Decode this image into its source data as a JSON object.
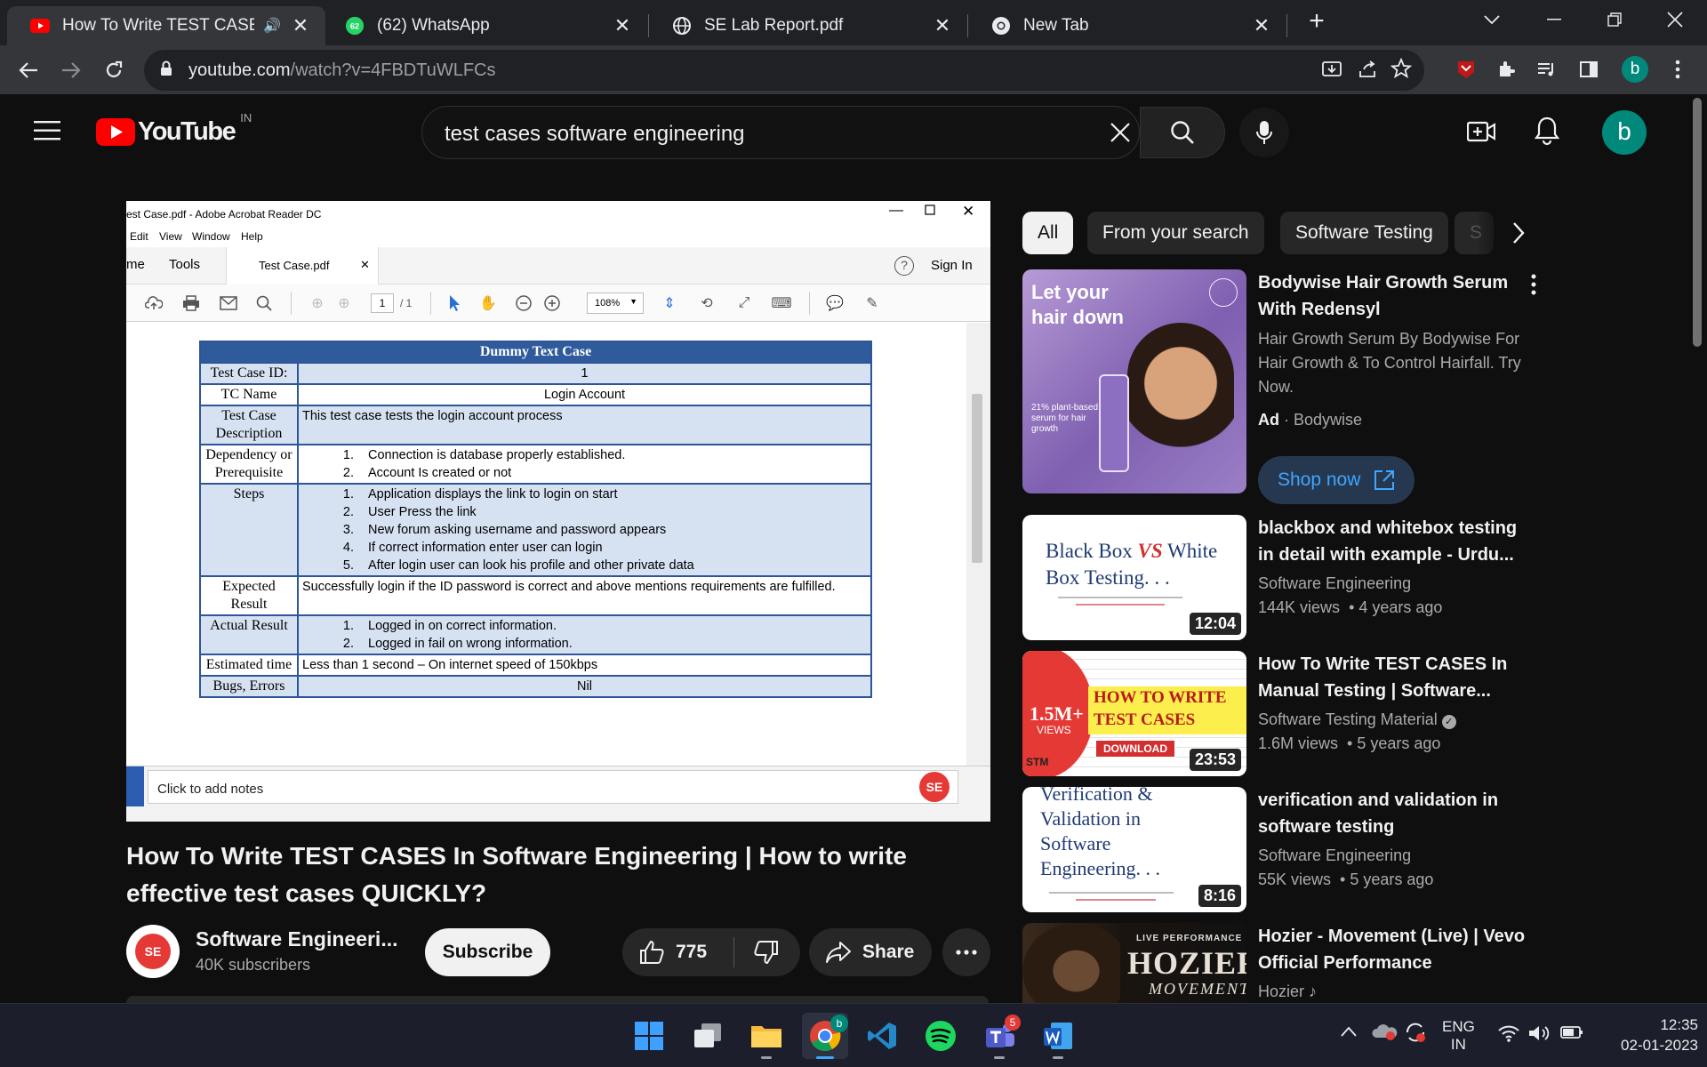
{
  "browser": {
    "tabs": [
      {
        "title": "How To Write TEST CASES In",
        "icon": "youtube-icon"
      },
      {
        "title": "(62) WhatsApp",
        "icon": "whatsapp-icon",
        "badge": "62"
      },
      {
        "title": "SE Lab Report.pdf",
        "icon": "globe-icon"
      },
      {
        "title": "New Tab",
        "icon": "chrome-icon"
      }
    ],
    "url_domain": "youtube.com",
    "url_path": "/watch?v=4FBDTuWLFCs",
    "profile_initial": "b"
  },
  "youtube": {
    "logo_text": "YouTube",
    "region": "IN",
    "search_query": "test cases software engineering",
    "avatar_initial": "b"
  },
  "acrobat": {
    "window_title": "est Case.pdf - Adobe Acrobat Reader DC",
    "menu": [
      "Edit",
      "View",
      "Window",
      "Help"
    ],
    "tab_home": "me",
    "tab_tools": "Tools",
    "tab_doc": "Test Case.pdf",
    "sign_in": "Sign In",
    "page_current": "1",
    "page_total": "/ 1",
    "zoom": "108%",
    "notes_placeholder": "Click to add notes",
    "table": {
      "heading": "Dummy Text Case",
      "rows": {
        "id_label": "Test Case ID:",
        "id_value": "1",
        "name_label": "TC Name",
        "name_value": "Login Account",
        "desc_label": "Test Case Description",
        "desc_value": "This test case tests the login account process",
        "dep_label": "Dependency or Prerequisite",
        "dep_items": [
          "Connection is database properly established.",
          "Account Is created or not"
        ],
        "steps_label": "Steps",
        "steps_items": [
          "Application displays the link to login on start",
          "User Press the link",
          "New forum asking username and password appears",
          "If correct information enter user can login",
          "After login user can look his profile and other private data"
        ],
        "expected_label": "Expected Result",
        "expected_value": "Successfully login if the ID password is correct and above mentions requirements are fulfilled.",
        "actual_label": "Actual Result",
        "actual_items": [
          "Logged in on correct information.",
          "Logged in fail on wrong information."
        ],
        "time_label": "Estimated time",
        "time_value": "Less than 1 second – On internet speed of 150kbps",
        "bugs_label": "Bugs, Errors",
        "bugs_value": "Nil"
      }
    }
  },
  "video": {
    "title": "How To Write TEST CASES In Software Engineering | How to write effective test cases QUICKLY?",
    "channel": "Software Engineeri...",
    "subscribers": "40K subscribers",
    "subscribe_label": "Subscribe",
    "likes": "775",
    "share_label": "Share",
    "channel_badge": "SE"
  },
  "chips": [
    "All",
    "From your search",
    "Software Testing",
    "S"
  ],
  "ad": {
    "title": "Bodywise Hair Growth Serum With Redensyl",
    "description": "Hair Growth Serum By Bodywise For Hair Growth & To Control Hairfall. Try Now.",
    "ad_label": "Ad",
    "advertiser": "Bodywise",
    "cta": "Shop now",
    "thumb_headline": "Let your hair down",
    "thumb_small": "21% plant-based serum for hair growth"
  },
  "recommendations": [
    {
      "title": "blackbox and whitebox testing in detail with example - Urdu...",
      "channel": "Software Engineering",
      "views": "144K views",
      "age": "4 years ago",
      "duration": "12:04",
      "thumb_line1": "Black Box",
      "thumb_vs": "VS",
      "thumb_line1b": "White",
      "thumb_line2": "Box Testing. . ."
    },
    {
      "title": "How To Write TEST CASES In Manual Testing | Software...",
      "channel": "Software Testing Material",
      "views": "1.6M views",
      "age": "5 years ago",
      "duration": "23:53",
      "thumb_big": "1.5M+",
      "thumb_views": "VIEWS",
      "thumb_line1": "HOW TO WRITE",
      "thumb_line2": "TEST CASES",
      "thumb_download": "DOWNLOAD",
      "thumb_logo": "STM"
    },
    {
      "title": "verification and validation in software testing",
      "channel": "Software Engineering",
      "views": "55K views",
      "age": "5 years ago",
      "duration": "8:16",
      "thumb_text": "Verification & Validation in Software Engineering. . ."
    },
    {
      "title": "Hozier - Movement (Live) | Vevo Official Performance",
      "channel": "Hozier",
      "thumb_small": "LIVE PERFORMANCE",
      "thumb_big": "HOZIER",
      "thumb_sub": "MOVEMENT"
    }
  ],
  "system": {
    "lang": "ENG",
    "lang_region": "IN",
    "time": "12:35",
    "date": "02-01-2023",
    "teams_badge": "5",
    "chrome_badge": "b"
  },
  "colors": {
    "yt_red": "#ff0000",
    "link_blue": "#3ea6ff",
    "avatar_green": "#00897b",
    "table_blue": "#2f5a9c"
  }
}
